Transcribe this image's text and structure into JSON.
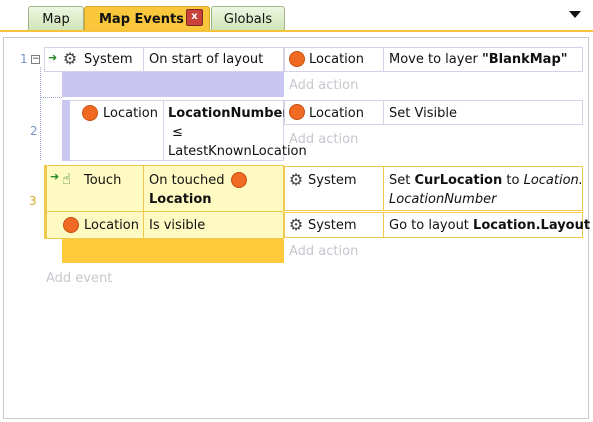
{
  "tabs": [
    {
      "label": "Map"
    },
    {
      "label": "Map Events"
    },
    {
      "label": "Globals"
    }
  ],
  "close_symbol": "x",
  "events": [
    {
      "number": "1",
      "condition": {
        "object": "System",
        "text": "On start of layout"
      },
      "action": {
        "object": "Location",
        "text_plain": "Move to layer ",
        "text_bold": "\"BlankMap\""
      },
      "add_action": "Add action"
    },
    {
      "number": "2",
      "condition": {
        "object": "Location",
        "text_bold": "LocationNumber",
        "operator": "≤",
        "value": "LatestKnownLocation"
      },
      "action": {
        "object": "Location",
        "text": "Set Visible"
      },
      "add_action": "Add action"
    },
    {
      "number": "3",
      "conditions": [
        {
          "object": "Touch",
          "text_plain": "On touched",
          "text_bold": "Location"
        },
        {
          "object": "Location",
          "text": "Is visible"
        }
      ],
      "actions": [
        {
          "object": "System",
          "text_plain": "Set ",
          "text_bold": "CurLocation",
          "text_mid": " to ",
          "text_italic": "Location.",
          "text_italic2": "LocationNumber"
        },
        {
          "object": "System",
          "text_plain": "Go to layout ",
          "text_bold": "Location.Layout"
        }
      ],
      "add_action": "Add action"
    }
  ],
  "add_event": "Add event",
  "icons": {
    "system": "gear-icon",
    "location": "orange-circle-icon",
    "touch": "hand-icon",
    "trigger": "green-arrow-icon",
    "collapse": "minus-icon"
  },
  "colors": {
    "active_tab": "#f9c63c",
    "selected_event": "#ffc93c",
    "event_block": "#c9c6f2",
    "trigger_cell": "#fffac2"
  }
}
